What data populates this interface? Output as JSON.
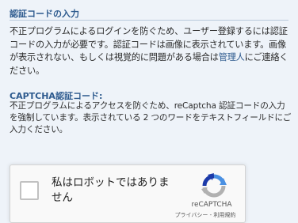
{
  "section": {
    "title": "認証コードの入力"
  },
  "intro": {
    "text_before_link": "不正プログラムによるログインを防ぐため、ユーザー登録するには認証コードの入力が必要です。認証コードは画像に表示されています。画像が表示されない、もしくは視覚的に問題がある場合は",
    "link_text": "管理人",
    "text_after_link": "にご連絡ください。"
  },
  "captcha": {
    "label": "CAPTCHA認証コード:",
    "description": "不正プログラムによるアクセスを防ぐため、reCaptcha 認証コードの入力を強制しています。表示されている 2 つのワードをテキストフィールドにご入力ください。"
  },
  "recaptcha": {
    "checkbox_label": "私はロボットではありません",
    "brand": "reCAPTCHA",
    "privacy_link": "プライバシー",
    "separator": " - ",
    "terms_link": "利用規約",
    "checked": false,
    "logo_icon": "recaptcha-logo-icon",
    "colors": {
      "logo_blue": "#1c3aa9",
      "logo_light_blue": "#4a90e2",
      "logo_gray": "#b1b1b1"
    }
  },
  "colors": {
    "background": "#eef3f9",
    "heading": "#2d5a8e",
    "text": "#2b2b2b"
  }
}
